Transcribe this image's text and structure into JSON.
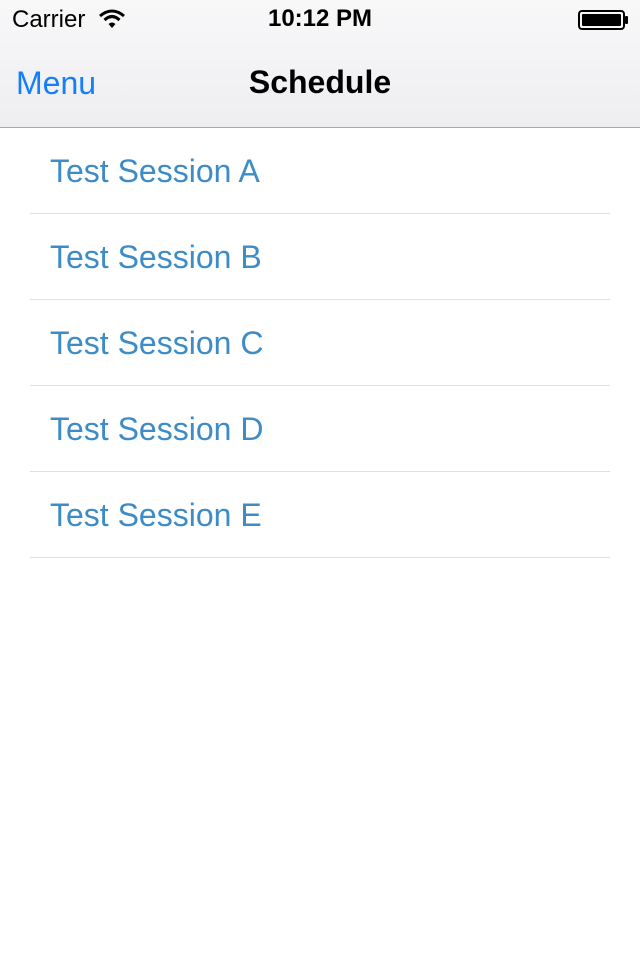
{
  "status_bar": {
    "carrier": "Carrier",
    "time": "10:12 PM",
    "wifi_icon": "wifi-icon",
    "battery_icon": "battery-icon"
  },
  "nav_bar": {
    "back_label": "Menu",
    "title": "Schedule"
  },
  "sessions": [
    {
      "label": "Test Session A"
    },
    {
      "label": "Test Session B"
    },
    {
      "label": "Test Session C"
    },
    {
      "label": "Test Session D"
    },
    {
      "label": "Test Session E"
    }
  ],
  "colors": {
    "link_blue": "#157efb",
    "session_text": "#3d8bc7",
    "separator": "#e0e0e2",
    "nav_background": "#f0f0f2"
  }
}
